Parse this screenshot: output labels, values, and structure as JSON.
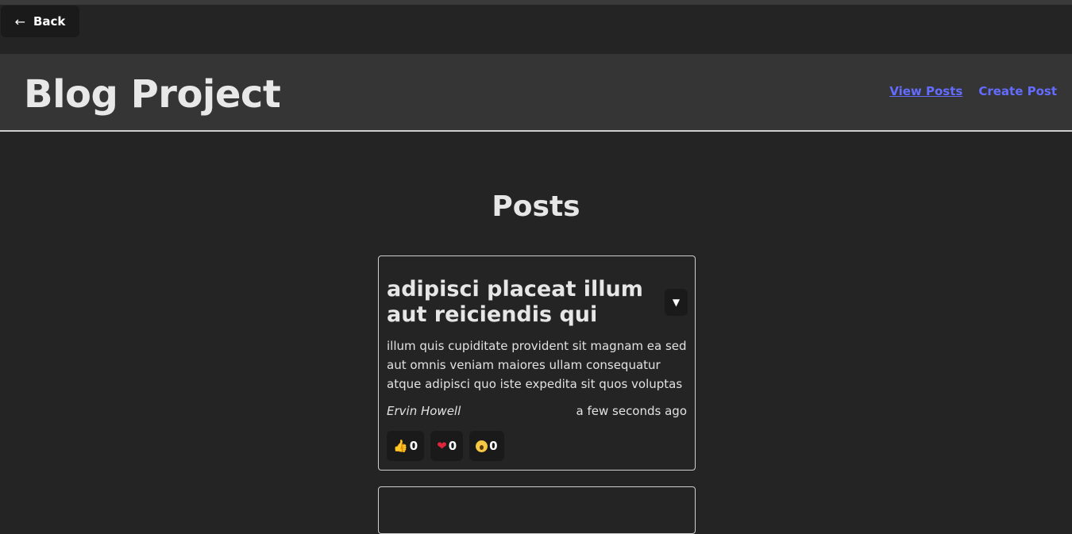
{
  "back": {
    "arrow": "←",
    "label": "Back"
  },
  "header": {
    "title": "Blog Project",
    "nav": [
      {
        "label": "View Posts",
        "active": true
      },
      {
        "label": "Create Post",
        "active": false
      }
    ]
  },
  "main": {
    "heading": "Posts",
    "posts": [
      {
        "title": "adipisci placeat illum aut reiciendis qui",
        "menu_icon": "▼",
        "body": "illum quis cupiditate provident sit magnam ea sed aut omnis veniam maiores ullam consequatur atque adipisci quo iste expedita sit quos voluptas",
        "author": "Ervin Howell",
        "time": "a few seconds ago",
        "reactions": [
          {
            "icon": "thumbs-up-icon",
            "count": "0"
          },
          {
            "icon": "heart-icon",
            "count": "0"
          },
          {
            "icon": "surprised-face-icon",
            "count": "0"
          }
        ]
      }
    ]
  },
  "colors": {
    "background": "#242424",
    "header_bg": "#353535",
    "link": "#646cff",
    "button_bg": "#1a1a1a"
  }
}
